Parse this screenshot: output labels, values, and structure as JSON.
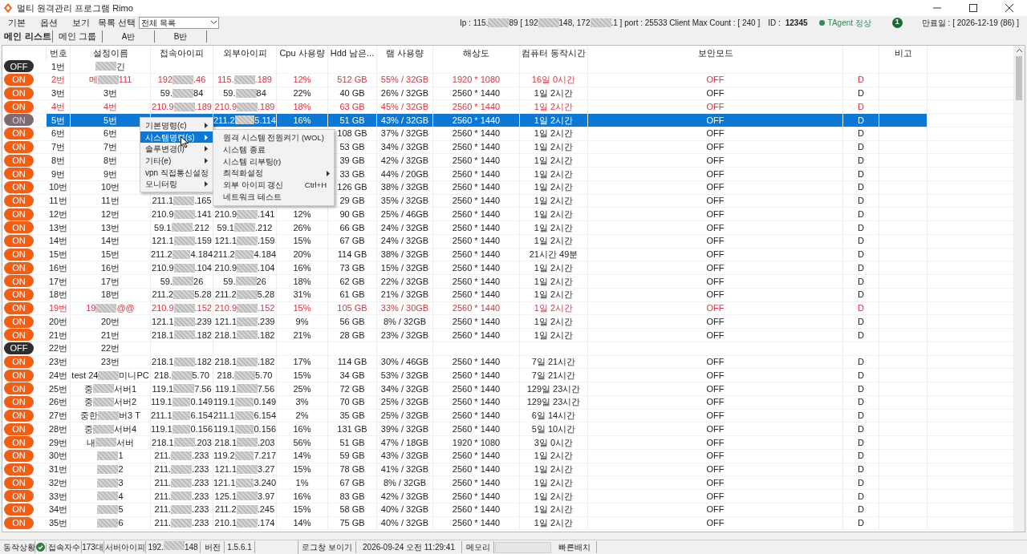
{
  "window": {
    "title": "멀티 원격관리 프로그램 Rimo"
  },
  "menu": [
    "기본",
    "옵션",
    "보기"
  ],
  "list_select": {
    "label": "목록 선택",
    "value": "전체 목록"
  },
  "info": {
    "ip": [
      "Ip : 115.",
      "89 [ 192",
      "148, 172",
      ".1 ]  port : 25533 Client Max Count :  [ 240 ]"
    ],
    "id_label": "ID :",
    "id": "12345",
    "agent": "TAgent 정상",
    "agent_ok": true,
    "badge": "1",
    "expiry": "만료일 : [ 2026-12-19 (86) ]"
  },
  "tabs": [
    {
      "label": "메인 리스트",
      "selected": true
    },
    {
      "label": "메인 그룹",
      "selected": false
    },
    {
      "label": "A반",
      "selected": false
    },
    {
      "label": "B반",
      "selected": false
    }
  ],
  "columns": [
    "번호",
    "설정이름",
    "접속아이피",
    "외부아이피",
    "Cpu 사용량",
    "Hdd 남은...",
    "램 사용량",
    "해상도",
    "컴퓨터 동작시간",
    "보안모드"
  ],
  "notes_column": "비고",
  "rows": [
    {
      "toggle": "OFF",
      "on": false,
      "selected": false,
      "alert": false,
      "no": "1번",
      "name": {
        "after": "긴"
      }
    },
    {
      "toggle": "ON",
      "on": true,
      "selected": false,
      "alert": true,
      "no": "2번",
      "name": [
        "메",
        "111"
      ],
      "ip": [
        "192",
        ".46"
      ],
      "ext_ip": [
        "115.",
        ".189"
      ],
      "cpu": "12%",
      "hdd": "512 GB",
      "ram": "55% / 32GB",
      "resolution": "1920 * 1080",
      "uptime": "16일 0시간",
      "mode": "OFF",
      "column_12": "D"
    },
    {
      "toggle": "ON",
      "on": true,
      "selected": false,
      "alert": false,
      "no": "3번",
      "name": [
        "3번"
      ],
      "ip": [
        "59.",
        "84"
      ],
      "ext_ip": [
        "59.",
        "84"
      ],
      "cpu": "22%",
      "hdd": "40 GB",
      "ram": "26% / 32GB",
      "resolution": "2560 * 1440",
      "uptime": "1일 2시간",
      "mode": "OFF",
      "column_12": "D"
    },
    {
      "toggle": "ON",
      "on": true,
      "selected": false,
      "alert": true,
      "no": "4번",
      "name": [
        "4번"
      ],
      "ip": [
        "210.9",
        ".189"
      ],
      "ext_ip": [
        "210.9",
        ".189"
      ],
      "cpu": "18%",
      "hdd": "63 GB",
      "ram": "45% / 32GB",
      "resolution": "2560 * 1440",
      "uptime": "1일 2시간",
      "mode": "OFF",
      "column_12": "D"
    },
    {
      "toggle": "ON",
      "on": true,
      "selected": true,
      "alert": false,
      "no": "5번",
      "name": [
        "5번"
      ],
      "ext_ip": [
        "211.2",
        "5.114"
      ],
      "cpu": "16%",
      "hdd": "51 GB",
      "ram": "43% / 32GB",
      "resolution": "2560 * 1440",
      "uptime": "1일 2시간",
      "mode": "OFF",
      "column_12": "D"
    },
    {
      "toggle": "ON",
      "on": true,
      "selected": false,
      "alert": false,
      "no": "6번",
      "name": [
        "6번"
      ],
      "hdd": "108 GB",
      "ram": "37% / 32GB",
      "resolution": "2560 * 1440",
      "uptime": "1일 2시간",
      "mode": "OFF",
      "column_12": "D"
    },
    {
      "toggle": "ON",
      "on": true,
      "selected": false,
      "alert": false,
      "no": "7번",
      "name": [
        "7번"
      ],
      "hdd": "53 GB",
      "ram": "34% / 32GB",
      "resolution": "2560 * 1440",
      "uptime": "1일 2시간",
      "mode": "OFF",
      "column_12": "D"
    },
    {
      "toggle": "ON",
      "on": true,
      "selected": false,
      "alert": false,
      "no": "8번",
      "name": [
        "8번"
      ],
      "hdd": "39 GB",
      "ram": "42% / 32GB",
      "resolution": "2560 * 1440",
      "uptime": "1일 2시간",
      "mode": "OFF",
      "column_12": "D"
    },
    {
      "toggle": "ON",
      "on": true,
      "selected": false,
      "alert": false,
      "no": "9번",
      "name": [
        "9번"
      ],
      "hdd": "33 GB",
      "ram": "44% / 20GB",
      "resolution": "2560 * 1440",
      "uptime": "1일 2시간",
      "mode": "OFF",
      "column_12": "D"
    },
    {
      "toggle": "ON",
      "on": true,
      "selected": false,
      "alert": false,
      "no": "10번",
      "name": [
        "10번"
      ],
      "hdd": "126 GB",
      "ram": "38% / 32GB",
      "resolution": "2560 * 1440",
      "uptime": "1일 2시간",
      "mode": "OFF",
      "column_12": "D"
    },
    {
      "toggle": "ON",
      "on": true,
      "selected": false,
      "alert": false,
      "no": "11번",
      "name": [
        "11번"
      ],
      "ip": [
        "211.1",
        ".165"
      ],
      "hdd": "29 GB",
      "ram": "35% / 32GB",
      "resolution": "2560 * 1440",
      "uptime": "1일 2시간",
      "mode": "OFF",
      "column_12": "D"
    },
    {
      "toggle": "ON",
      "on": true,
      "selected": false,
      "alert": false,
      "no": "12번",
      "name": [
        "12번"
      ],
      "ip": [
        "210.9",
        ".141"
      ],
      "ext_ip": [
        "210.9",
        ".141"
      ],
      "cpu": "12%",
      "hdd": "90 GB",
      "ram": "25% / 46GB",
      "resolution": "2560 * 1440",
      "uptime": "1일 2시간",
      "mode": "OFF",
      "column_12": "D"
    },
    {
      "toggle": "ON",
      "on": true,
      "selected": false,
      "alert": false,
      "no": "13번",
      "name": [
        "13번"
      ],
      "ip": [
        "59.1",
        ".212"
      ],
      "ext_ip": [
        "59.1",
        ".212"
      ],
      "cpu": "26%",
      "hdd": "66 GB",
      "ram": "24% / 32GB",
      "resolution": "2560 * 1440",
      "uptime": "1일 2시간",
      "mode": "OFF",
      "column_12": "D"
    },
    {
      "toggle": "ON",
      "on": true,
      "selected": false,
      "alert": false,
      "no": "14번",
      "name": [
        "14번"
      ],
      "ip": [
        "121.1",
        ".159"
      ],
      "ext_ip": [
        "121.1",
        ".159"
      ],
      "cpu": "15%",
      "hdd": "67 GB",
      "ram": "24% / 32GB",
      "resolution": "2560 * 1440",
      "uptime": "1일 2시간",
      "mode": "OFF",
      "column_12": "D"
    },
    {
      "toggle": "ON",
      "on": true,
      "selected": false,
      "alert": false,
      "no": "15번",
      "name": [
        "15번"
      ],
      "ip": [
        "211.2",
        "4.184"
      ],
      "ext_ip": [
        "211.2",
        "4.184"
      ],
      "cpu": "20%",
      "hdd": "114 GB",
      "ram": "38% / 32GB",
      "resolution": "2560 * 1440",
      "uptime": "21시간 49분",
      "mode": "OFF",
      "column_12": "D"
    },
    {
      "toggle": "ON",
      "on": true,
      "selected": false,
      "alert": false,
      "no": "16번",
      "name": [
        "16번"
      ],
      "ip": [
        "210.9",
        ".104"
      ],
      "ext_ip": [
        "210.9",
        ".104"
      ],
      "cpu": "16%",
      "hdd": "73 GB",
      "ram": "15% / 32GB",
      "resolution": "2560 * 1440",
      "uptime": "1일 2시간",
      "mode": "OFF",
      "column_12": "D"
    },
    {
      "toggle": "ON",
      "on": true,
      "selected": false,
      "alert": false,
      "no": "17번",
      "name": [
        "17번"
      ],
      "ip": [
        "59.",
        "26"
      ],
      "ext_ip": [
        "59.",
        "26"
      ],
      "cpu": "18%",
      "hdd": "62 GB",
      "ram": "22% / 32GB",
      "resolution": "2560 * 1440",
      "uptime": "1일 2시간",
      "mode": "OFF",
      "column_12": "D"
    },
    {
      "toggle": "ON",
      "on": true,
      "selected": false,
      "alert": false,
      "no": "18번",
      "name": [
        "18번"
      ],
      "ip": [
        "211.2",
        "5.28"
      ],
      "ext_ip": [
        "211.2",
        "5.28"
      ],
      "cpu": "31%",
      "hdd": "61 GB",
      "ram": "21% / 32GB",
      "resolution": "2560 * 1440",
      "uptime": "1일 2시간",
      "mode": "OFF",
      "column_12": "D"
    },
    {
      "toggle": "ON",
      "on": true,
      "selected": false,
      "alert": true,
      "no": "19번",
      "name": [
        "19",
        "@@"
      ],
      "ip": [
        "210.9",
        ".152"
      ],
      "ext_ip": [
        "210.9",
        ".152"
      ],
      "cpu": "15%",
      "hdd": "105 GB",
      "ram": "33% / 30GB",
      "resolution": "2560 * 1440",
      "uptime": "1일 2시간",
      "mode": "OFF",
      "column_12": "D"
    },
    {
      "toggle": "ON",
      "on": true,
      "selected": false,
      "alert": false,
      "no": "20번",
      "name": [
        "20번"
      ],
      "ip": [
        "121.1",
        ".239"
      ],
      "ext_ip": [
        "121.1",
        ".239"
      ],
      "cpu": "9%",
      "hdd": "56 GB",
      "ram": "8% / 32GB",
      "resolution": "2560 * 1440",
      "uptime": "1일 2시간",
      "mode": "OFF",
      "column_12": "D"
    },
    {
      "toggle": "ON",
      "on": true,
      "selected": false,
      "alert": false,
      "no": "21번",
      "name": [
        "21번"
      ],
      "ip": [
        "218.1",
        ".182"
      ],
      "ext_ip": [
        "218.1",
        ".182"
      ],
      "cpu": "21%",
      "hdd": "28 GB",
      "ram": "23% / 32GB",
      "resolution": "2560 * 1440",
      "uptime": "1일 2시간",
      "mode": "OFF",
      "column_12": "D"
    },
    {
      "toggle": "OFF",
      "on": false,
      "selected": false,
      "alert": false,
      "no": "22번",
      "name": [
        "22번"
      ]
    },
    {
      "toggle": "ON",
      "on": true,
      "selected": false,
      "alert": false,
      "no": "23번",
      "name": [
        "23번"
      ],
      "ip": [
        "218.1",
        ".182"
      ],
      "ext_ip": [
        "218.1",
        ".182"
      ],
      "cpu": "17%",
      "hdd": "114 GB",
      "ram": "30% / 46GB",
      "resolution": "2560 * 1440",
      "uptime": "7일 21시간",
      "mode": "OFF",
      "column_12": "D"
    },
    {
      "toggle": "ON",
      "on": true,
      "selected": false,
      "alert": false,
      "no": "24번",
      "name": [
        "test 24",
        "미니PC"
      ],
      "ip": [
        "218.",
        "5.70"
      ],
      "ext_ip": [
        "218.",
        "5.70"
      ],
      "cpu": "15%",
      "hdd": "34 GB",
      "ram": "53% / 32GB",
      "resolution": "2560 * 1440",
      "uptime": "7일 21시간",
      "mode": "OFF",
      "column_12": "D"
    },
    {
      "toggle": "ON",
      "on": true,
      "selected": false,
      "alert": false,
      "no": "25번",
      "name": [
        "중",
        "서버1"
      ],
      "ip": [
        "119.1",
        "7.56"
      ],
      "ext_ip": [
        "119.1",
        "7.56"
      ],
      "cpu": "25%",
      "hdd": "72 GB",
      "ram": "34% / 32GB",
      "resolution": "2560 * 1440",
      "uptime": "129일 23시간",
      "mode": "OFF",
      "column_12": "D"
    },
    {
      "toggle": "ON",
      "on": true,
      "selected": false,
      "alert": false,
      "no": "26번",
      "name": [
        "중",
        "서버2"
      ],
      "ip": [
        "119.1",
        "0.149"
      ],
      "ext_ip": [
        "119.1",
        "0.149"
      ],
      "cpu": "3%",
      "hdd": "70 GB",
      "ram": "25% / 32GB",
      "resolution": "2560 * 1440",
      "uptime": "129일 23시간",
      "mode": "OFF",
      "column_12": "D"
    },
    {
      "toggle": "ON",
      "on": true,
      "selected": false,
      "alert": false,
      "no": "27번",
      "name": [
        "중한",
        "버3 T"
      ],
      "ip": [
        "211.1",
        "6.154"
      ],
      "ext_ip": [
        "211.1",
        "6.154"
      ],
      "cpu": "2%",
      "hdd": "35 GB",
      "ram": "25% / 32GB",
      "resolution": "2560 * 1440",
      "uptime": "6일 14시간",
      "mode": "OFF",
      "column_12": "D"
    },
    {
      "toggle": "ON",
      "on": true,
      "selected": false,
      "alert": false,
      "no": "28번",
      "name": [
        "중",
        "서버4"
      ],
      "ip": [
        "119.1",
        "0.156"
      ],
      "ext_ip": [
        "119.1",
        "0.156"
      ],
      "cpu": "16%",
      "hdd": "131 GB",
      "ram": "39% / 32GB",
      "resolution": "2560 * 1440",
      "uptime": "5일 10시간",
      "mode": "OFF",
      "column_12": "D"
    },
    {
      "toggle": "ON",
      "on": true,
      "selected": false,
      "alert": false,
      "no": "29번",
      "name": [
        "내",
        "서버"
      ],
      "ip": [
        "218.1",
        ".203"
      ],
      "ext_ip": [
        "218.1",
        ".203"
      ],
      "cpu": "56%",
      "hdd": "51 GB",
      "ram": "47% / 18GB",
      "resolution": "1920 * 1080",
      "uptime": "3일 0시간",
      "mode": "OFF",
      "column_12": "D"
    },
    {
      "toggle": "ON",
      "on": true,
      "selected": false,
      "alert": false,
      "no": "30번",
      "name": {
        "after": "1"
      },
      "ip": [
        "211.",
        ".233"
      ],
      "ext_ip": [
        "119.2",
        "7.217"
      ],
      "cpu": "14%",
      "hdd": "59 GB",
      "ram": "43% / 32GB",
      "resolution": "2560 * 1440",
      "uptime": "1일 2시간",
      "mode": "OFF",
      "column_12": "D"
    },
    {
      "toggle": "ON",
      "on": true,
      "selected": false,
      "alert": false,
      "no": "31번",
      "name": {
        "after": "2"
      },
      "ip": [
        "211.",
        ".233"
      ],
      "ext_ip": [
        "121.1",
        "3.27"
      ],
      "cpu": "15%",
      "hdd": "78 GB",
      "ram": "41% / 32GB",
      "resolution": "2560 * 1440",
      "uptime": "1일 2시간",
      "mode": "OFF",
      "column_12": "D"
    },
    {
      "toggle": "ON",
      "on": true,
      "selected": false,
      "alert": false,
      "no": "32번",
      "name": {
        "after": "3"
      },
      "ip": [
        "211.",
        ".233"
      ],
      "ext_ip": [
        "121.1",
        "3.240"
      ],
      "cpu": "1%",
      "hdd": "67 GB",
      "ram": "8% / 32GB",
      "resolution": "2560 * 1440",
      "uptime": "1일 2시간",
      "mode": "OFF",
      "column_12": "D"
    },
    {
      "toggle": "ON",
      "on": true,
      "selected": false,
      "alert": false,
      "no": "33번",
      "name": {
        "after": "4"
      },
      "ip": [
        "211.",
        ".233"
      ],
      "ext_ip": [
        "125.1",
        "3.97"
      ],
      "cpu": "16%",
      "hdd": "83 GB",
      "ram": "42% / 32GB",
      "resolution": "2560 * 1440",
      "uptime": "1일 2시간",
      "mode": "OFF",
      "column_12": "D"
    },
    {
      "toggle": "ON",
      "on": true,
      "selected": false,
      "alert": false,
      "no": "34번",
      "name": {
        "after": "5"
      },
      "ip": [
        "211.",
        ".233"
      ],
      "ext_ip": [
        "211.2",
        ".245"
      ],
      "cpu": "15%",
      "hdd": "58 GB",
      "ram": "40% / 32GB",
      "resolution": "2560 * 1440",
      "uptime": "1일 2시간",
      "mode": "OFF",
      "column_12": "D"
    },
    {
      "toggle": "ON",
      "on": true,
      "selected": false,
      "alert": false,
      "no": "35번",
      "name": {
        "after": "6"
      },
      "ip": [
        "211.",
        ".233"
      ],
      "ext_ip": [
        "210.1",
        ".174"
      ],
      "cpu": "14%",
      "hdd": "75 GB",
      "ram": "40% / 32GB",
      "resolution": "2560 * 1440",
      "uptime": "1일 2시간",
      "mode": "OFF",
      "column_12": "D"
    }
  ],
  "context_menu": [
    {
      "label": "기본명령(c)",
      "selected": false
    },
    {
      "label": "시스템명령(s)",
      "selected": true
    },
    {
      "label": "솔루변경(l)",
      "selected": false
    },
    {
      "label": "기타(e)",
      "selected": false
    },
    {
      "label": "vpn 직접통신설정",
      "selected": false
    },
    {
      "label": "모니터링",
      "selected": false
    }
  ],
  "submenu": [
    {
      "label": "원격 시스템 전원켜기 (WOL)",
      "submenu": false
    },
    {
      "label": "시스템 종료",
      "submenu": false
    },
    {
      "label": "시스템 리부팅(r)",
      "submenu": false
    },
    {
      "label": "최적화설정",
      "submenu": true
    },
    {
      "label": "외부 아이피 갱신",
      "shortcut": "Ctrl+H",
      "submenu": false
    },
    {
      "label": "네트워크 테스트",
      "submenu": false
    }
  ],
  "status_bar": {
    "state_label": "동작상황",
    "state_ok": true,
    "users_label": "접속자수",
    "users": "173대",
    "server_ip_label": "서버아이피",
    "server_ip": [
      "192.",
      "148"
    ],
    "version_label": "버전",
    "version": "1.5.6.1",
    "log_button": "로그창 보이기",
    "datetime": "2026-09-24 오전 11:29:41",
    "memory_label": "메모리",
    "quick_button": "빠른배치"
  }
}
